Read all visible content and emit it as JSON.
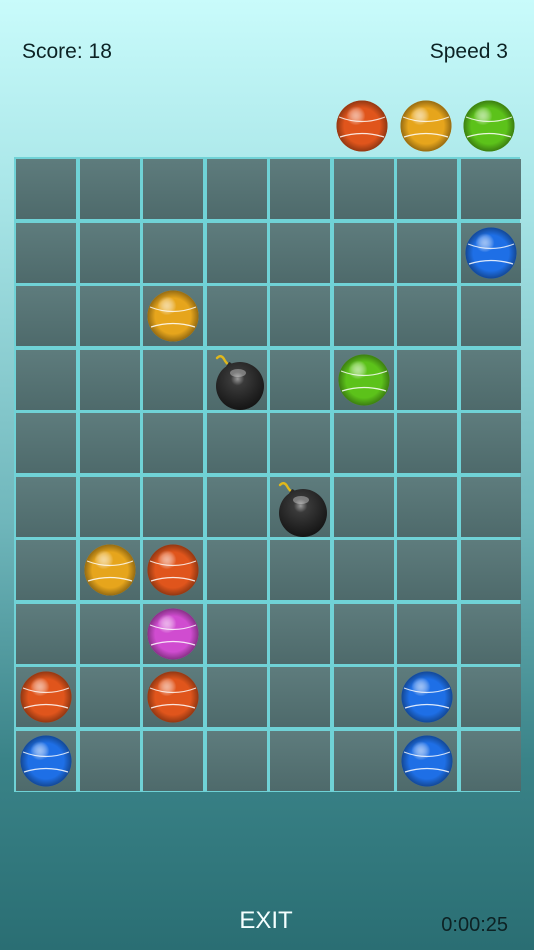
{
  "hud": {
    "score_label": "Score:  18",
    "speed_label": "Speed 3"
  },
  "controls": {
    "exit_label": "EXIT"
  },
  "timer": "0:00:25",
  "colors": {
    "red": "#e0551c",
    "orange": "#e6a51c",
    "green": "#5cc21a",
    "blue": "#1e6fe6",
    "purple": "#d04cd0",
    "bomb": "#111111",
    "grid": "#70d2d6"
  },
  "next_balls": [
    "red",
    "orange",
    "green"
  ],
  "board": {
    "cols": 8,
    "rows": 10,
    "pieces": [
      {
        "row": 1,
        "col": 7,
        "type": "ball",
        "color": "blue"
      },
      {
        "row": 2,
        "col": 2,
        "type": "ball",
        "color": "orange"
      },
      {
        "row": 3,
        "col": 3,
        "type": "bomb"
      },
      {
        "row": 3,
        "col": 5,
        "type": "ball",
        "color": "green"
      },
      {
        "row": 5,
        "col": 4,
        "type": "bomb"
      },
      {
        "row": 6,
        "col": 1,
        "type": "ball",
        "color": "orange"
      },
      {
        "row": 6,
        "col": 2,
        "type": "ball",
        "color": "red"
      },
      {
        "row": 7,
        "col": 2,
        "type": "ball",
        "color": "purple"
      },
      {
        "row": 8,
        "col": 0,
        "type": "ball",
        "color": "red"
      },
      {
        "row": 8,
        "col": 2,
        "type": "ball",
        "color": "red"
      },
      {
        "row": 8,
        "col": 6,
        "type": "ball",
        "color": "blue"
      },
      {
        "row": 9,
        "col": 0,
        "type": "ball",
        "color": "blue"
      },
      {
        "row": 9,
        "col": 6,
        "type": "ball",
        "color": "blue"
      }
    ]
  }
}
